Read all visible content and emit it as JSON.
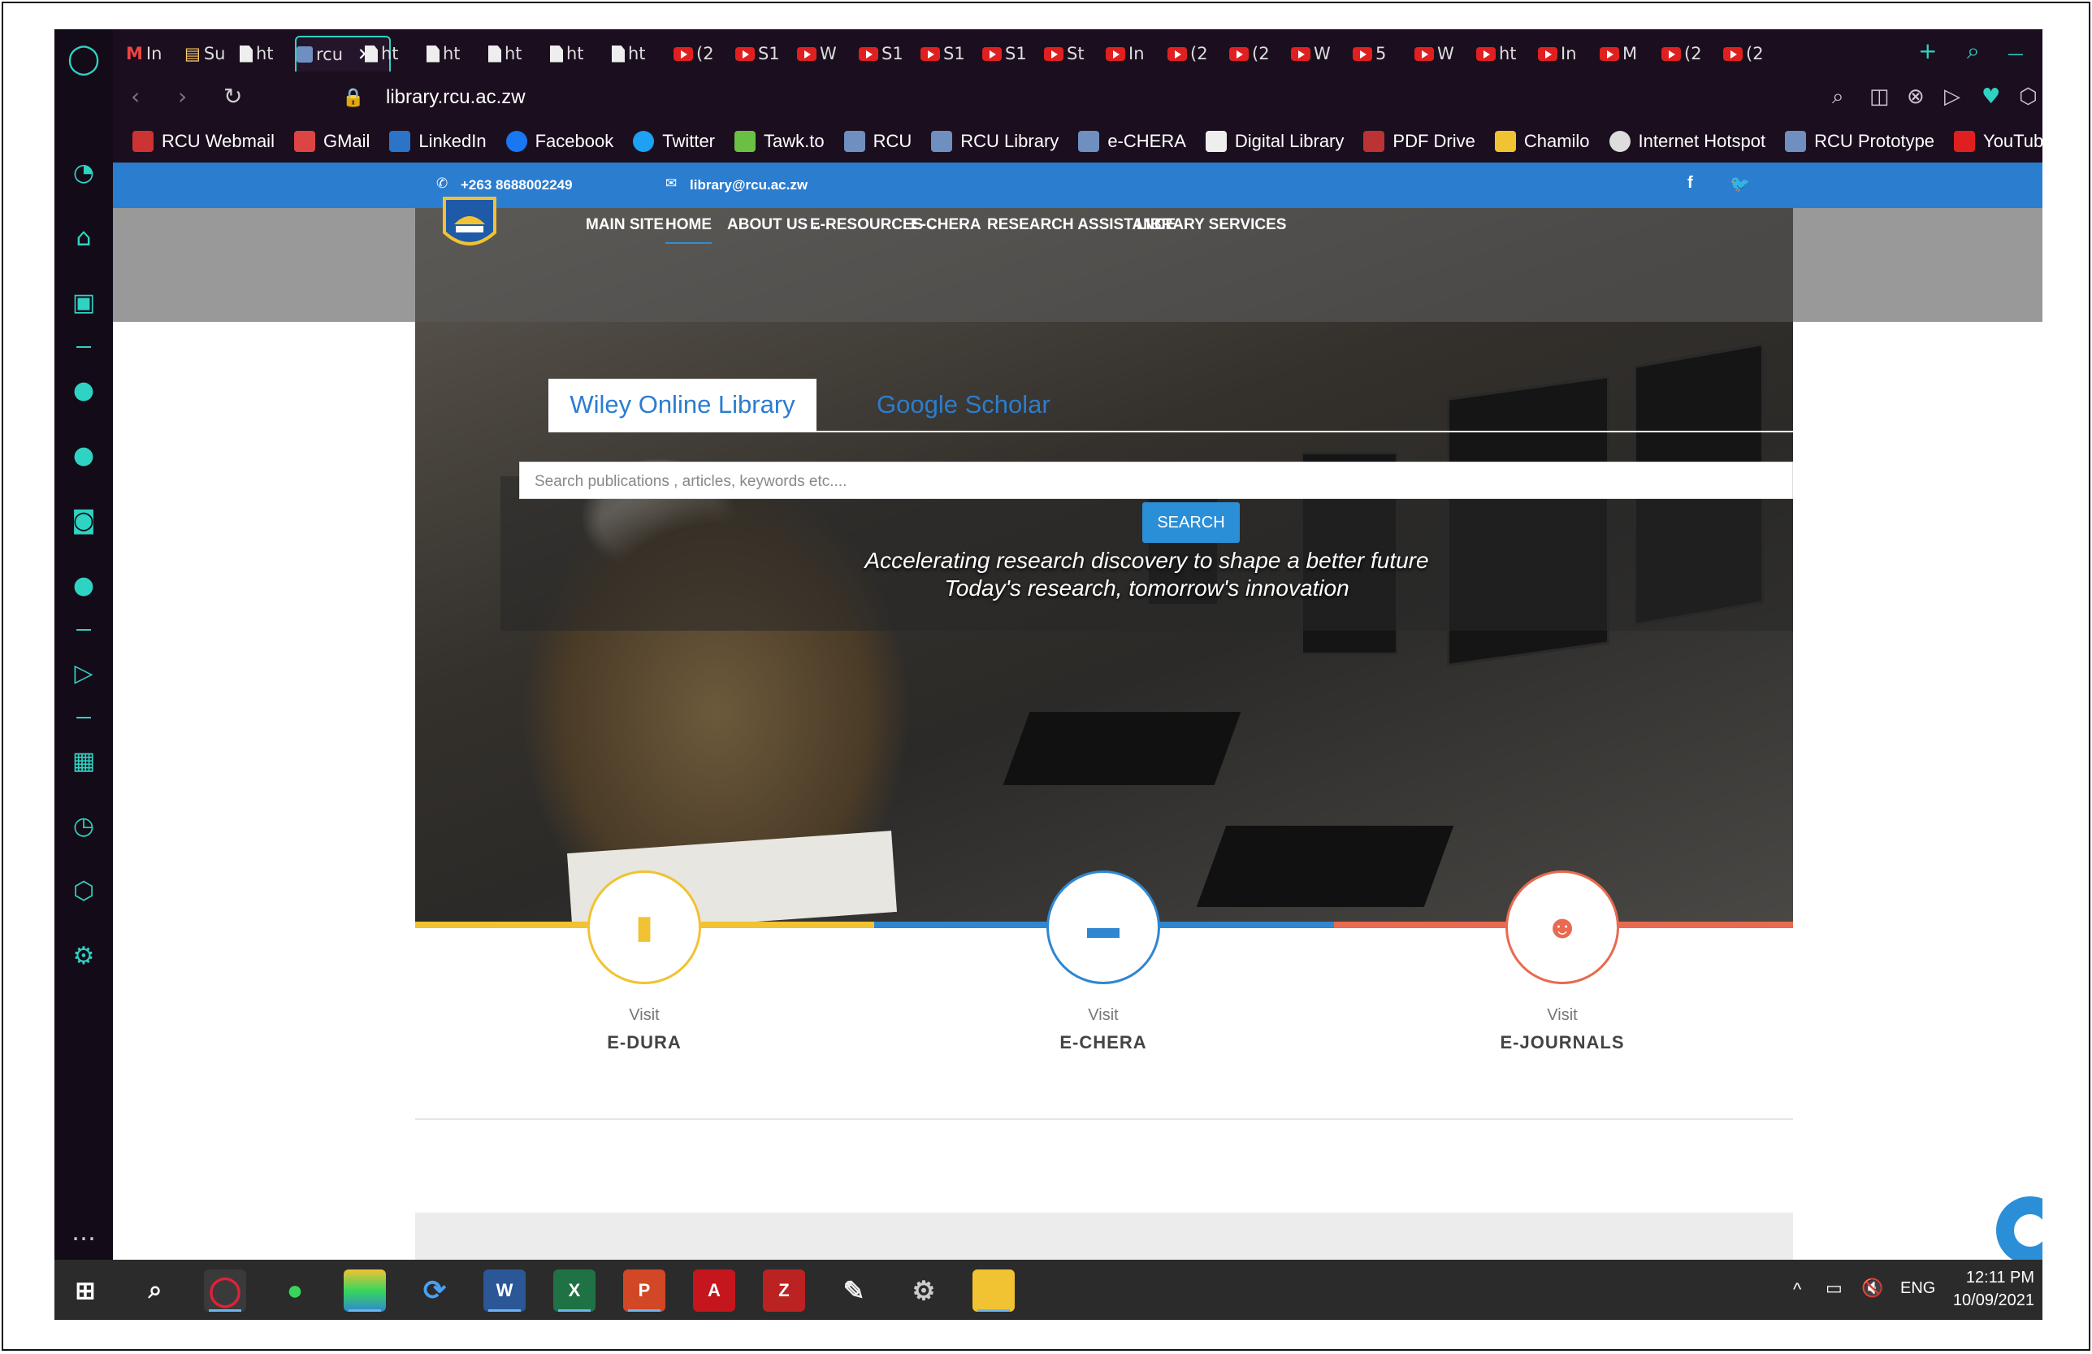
{
  "tabs": [
    {
      "icon": "gmail",
      "label": "In"
    },
    {
      "icon": "100",
      "label": "Su"
    },
    {
      "icon": "doc",
      "label": "ht"
    },
    {
      "icon": "rcu",
      "label": "rcu",
      "active": true
    },
    {
      "icon": "doc",
      "label": "ht"
    },
    {
      "icon": "doc",
      "label": "ht"
    },
    {
      "icon": "doc",
      "label": "ht"
    },
    {
      "icon": "doc",
      "label": "ht"
    },
    {
      "icon": "doc",
      "label": "ht"
    },
    {
      "icon": "youtube",
      "label": "(2"
    },
    {
      "icon": "youtube",
      "label": "S1"
    },
    {
      "icon": "youtube",
      "label": "W"
    },
    {
      "icon": "youtube",
      "label": "S1"
    },
    {
      "icon": "youtube",
      "label": "S1"
    },
    {
      "icon": "youtube",
      "label": "S1"
    },
    {
      "icon": "youtube",
      "label": "St"
    },
    {
      "icon": "youtube",
      "label": "In"
    },
    {
      "icon": "youtube",
      "label": "(2"
    },
    {
      "icon": "youtube",
      "label": "(2"
    },
    {
      "icon": "youtube",
      "label": "W"
    },
    {
      "icon": "youtube",
      "label": "5"
    },
    {
      "icon": "youtube",
      "label": "W"
    },
    {
      "icon": "youtube",
      "label": "ht"
    },
    {
      "icon": "youtube",
      "label": "In"
    },
    {
      "icon": "youtube",
      "label": "M"
    },
    {
      "icon": "youtube",
      "label": "(2"
    },
    {
      "icon": "youtube",
      "label": "(2"
    }
  ],
  "address": {
    "url": "library.rcu.ac.zw"
  },
  "bookmarks": [
    "RCU Webmail",
    "GMail",
    "LinkedIn",
    "Facebook",
    "Twitter",
    "Tawk.to",
    "RCU",
    "RCU Library",
    "e-CHERA",
    "Digital Library",
    "PDF Drive",
    "Chamilo",
    "Internet Hotspot",
    "RCU Prototype",
    "YouTube"
  ],
  "topbar": {
    "phone": "+263 8688002249",
    "email": "library@rcu.ac.zw"
  },
  "menu": [
    "MAIN SITE",
    "HOME",
    "ABOUT US",
    "E-RESOURCES",
    "E-CHERA",
    "RESEARCH ASSISTANCE",
    "LIBRARY SERVICES"
  ],
  "search": {
    "tab_active": "Wiley Online Library",
    "tab_other": "Google Scholar",
    "placeholder": "Search publications , articles, keywords etc....",
    "button": "SEARCH"
  },
  "tagline": [
    "Accelerating research discovery to shape a better future",
    "Today's research, tomorrow's innovation"
  ],
  "cards": [
    {
      "visit": "Visit",
      "title": "E-DURA",
      "color": "#f1c232",
      "icon": "book-icon"
    },
    {
      "visit": "Visit",
      "title": "E-CHERA",
      "color": "#2f86d1",
      "icon": "folder-icon"
    },
    {
      "visit": "Visit",
      "title": "E-JOURNALS",
      "color": "#e86a50",
      "icon": "users-icon"
    }
  ],
  "taskbar": {
    "time": "12:11 PM",
    "date": "10/09/2021",
    "lang": "ENG"
  },
  "colors": {
    "accent": "#2fd3c3",
    "topbar": "#2b7dd0",
    "browser_bg": "#1b0f1f"
  }
}
